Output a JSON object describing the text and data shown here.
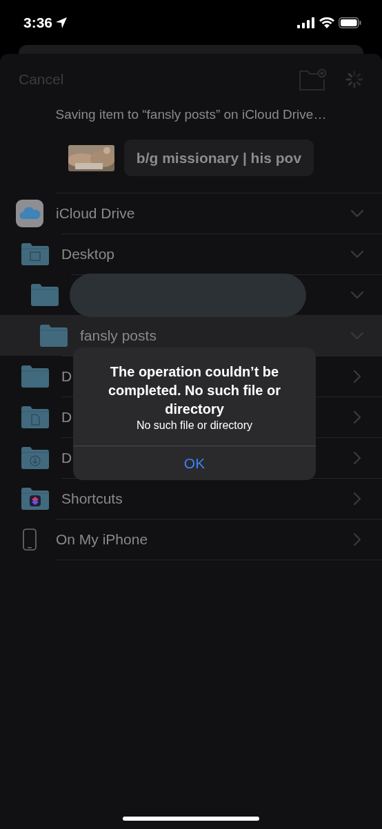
{
  "status_bar": {
    "time": "3:36"
  },
  "toolbar": {
    "cancel": "Cancel"
  },
  "caption": "Saving item to “fansly posts” on iCloud Drive…",
  "item": {
    "name": "b/g missionary | his pov"
  },
  "locations": [
    {
      "kind": "cloud",
      "name": "iCloud Drive",
      "expanded": true,
      "selected": false,
      "children": [
        {
          "kind": "desktop",
          "name": "Desktop",
          "expanded": true,
          "selected": false,
          "children": [
            {
              "kind": "folder",
              "redacted": true,
              "expanded": true,
              "selected": false,
              "children": [
                {
                  "kind": "folder",
                  "name": "fansly posts",
                  "expanded": true,
                  "selected": true
                }
              ]
            }
          ]
        },
        {
          "kind": "folder",
          "name": "D",
          "expanded": false,
          "selected": false
        },
        {
          "kind": "document",
          "name": "D",
          "expanded": false,
          "selected": false
        },
        {
          "kind": "download",
          "name": "D",
          "expanded": false,
          "selected": false
        },
        {
          "kind": "shortcuts",
          "name": "Shortcuts",
          "expanded": false,
          "selected": false
        }
      ]
    },
    {
      "kind": "phone",
      "name": "On My iPhone",
      "expanded": false,
      "selected": false
    }
  ],
  "alert": {
    "title": "The operation couldn’t be completed. No such file or directory",
    "message": "No such file or directory",
    "button": "OK"
  }
}
